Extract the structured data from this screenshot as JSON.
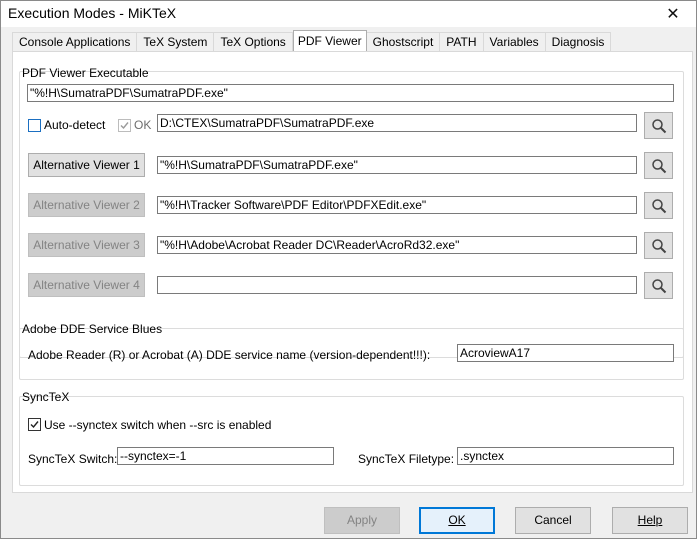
{
  "window": {
    "title": "Execution Modes - MiKTeX",
    "close_glyph": "✕"
  },
  "tabs": [
    {
      "label": "Console Applications",
      "active": false
    },
    {
      "label": "TeX System",
      "active": false
    },
    {
      "label": "TeX Options",
      "active": false
    },
    {
      "label": "PDF Viewer",
      "active": true
    },
    {
      "label": "Ghostscript",
      "active": false
    },
    {
      "label": "PATH",
      "active": false
    },
    {
      "label": "Variables",
      "active": false
    },
    {
      "label": "Diagnosis",
      "active": false
    }
  ],
  "pdf_viewer": {
    "group_label": "PDF Viewer Executable",
    "executable_value": "\"%!H\\SumatraPDF\\SumatraPDF.exe\"",
    "auto_detect_label": "Auto-detect",
    "auto_detect_checked": false,
    "ok_label": "OK",
    "ok_checked": true,
    "detected_path": "D:\\CTEX\\SumatraPDF\\SumatraPDF.exe",
    "alternatives": [
      {
        "label": "Alternative Viewer 1",
        "value": "\"%!H\\SumatraPDF\\SumatraPDF.exe\"",
        "enabled": true
      },
      {
        "label": "Alternative Viewer 2",
        "value": "\"%!H\\Tracker Software\\PDF Editor\\PDFXEdit.exe\"",
        "enabled": false
      },
      {
        "label": "Alternative Viewer 3",
        "value": "\"%!H\\Adobe\\Acrobat Reader DC\\Reader\\AcroRd32.exe\"",
        "enabled": false
      },
      {
        "label": "Alternative Viewer 4",
        "value": "",
        "enabled": false
      }
    ]
  },
  "adobe_dde": {
    "group_label": "Adobe DDE Service Blues",
    "service_label": "Adobe Reader (R) or Acrobat (A) DDE service name  (version-dependent!!!):",
    "service_value": "AcroviewA17"
  },
  "synctex": {
    "group_label": "SyncTeX",
    "use_switch_label": "Use --synctex switch when --src is enabled",
    "use_switch_checked": true,
    "switch_label": "SyncTeX Switch:",
    "switch_value": "--synctex=-1",
    "filetype_label": "SyncTeX Filetype:",
    "filetype_value": ".synctex"
  },
  "footer": {
    "apply_label": "Apply",
    "ok_label": "OK",
    "cancel_label": "Cancel",
    "help_label": "Help"
  },
  "icons": {
    "browse": "search-icon",
    "check": "checkmark-icon",
    "close": "close-icon"
  }
}
